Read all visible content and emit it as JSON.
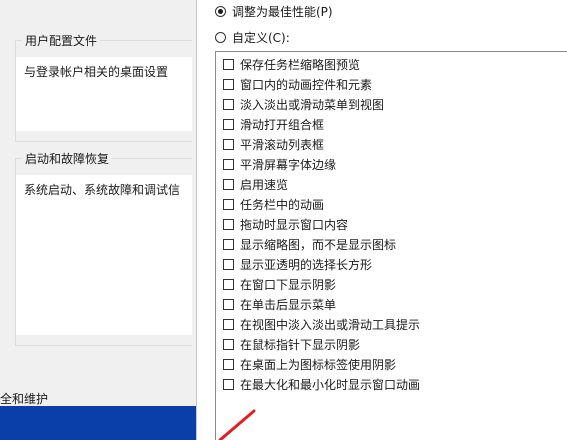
{
  "left": {
    "groups": [
      {
        "title": "用户配置文件",
        "desc": "与登录帐户相关的桌面设置"
      },
      {
        "title": "启动和故障恢复",
        "desc": "系统启动、系统故障和调试信"
      }
    ],
    "bottom_link": "全和维护"
  },
  "dialog": {
    "radios": [
      {
        "label": "调整为最佳性能(P)",
        "checked": true
      },
      {
        "label": "自定义(C):",
        "checked": false
      }
    ],
    "options": [
      "保存任务栏缩略图预览",
      "窗口内的动画控件和元素",
      "淡入淡出或滑动菜单到视图",
      "滑动打开组合框",
      "平滑滚动列表框",
      "平滑屏幕字体边缘",
      "启用速览",
      "任务栏中的动画",
      "拖动时显示窗口内容",
      "显示缩略图，而不是显示图标",
      "显示亚透明的选择长方形",
      "在窗口下显示阴影",
      "在单击后显示菜单",
      "在视图中淡入淡出或滑动工具提示",
      "在鼠标指针下显示阴影",
      "在桌面上为图标标签使用阴影",
      "在最大化和最小化时显示窗口动画"
    ]
  },
  "colors": {
    "taskbar": "#0a3ea8",
    "annotation_arrow": "#e02020"
  }
}
